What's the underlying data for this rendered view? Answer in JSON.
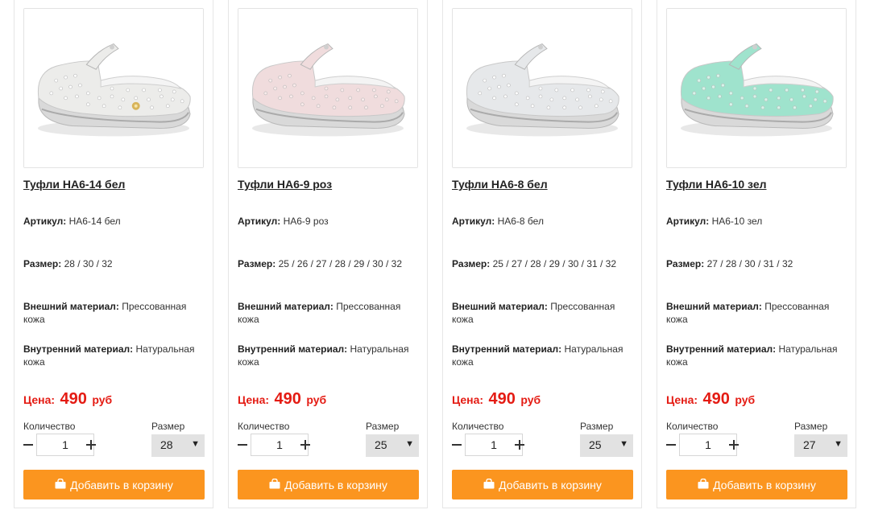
{
  "products": [
    {
      "title": "Туфли НА6-14 бел",
      "article_label": "Артикул:",
      "article": "НА6-14 бел",
      "size_label": "Размер:",
      "sizes": "28 / 30 / 32",
      "ext_label": "Внешний материал:",
      "ext_material": "Прессованная кожа",
      "int_label": "Внутренний материал:",
      "int_material": "Натуральная кожа",
      "price_label": "Цена:",
      "price": "490",
      "currency": "руб",
      "qty_label": "Количество",
      "qty": "1",
      "size_select_label": "Размер",
      "size_selected": "28",
      "cart_label": "Добавить в корзину",
      "color": "#ececea",
      "dot": "#ffffff",
      "brooch": true
    },
    {
      "title": "Туфли НА6-9 роз",
      "article_label": "Артикул:",
      "article": "НА6-9 роз",
      "size_label": "Размер:",
      "sizes": "25 / 26 / 27 / 28 / 29 / 30 / 32",
      "ext_label": "Внешний материал:",
      "ext_material": "Прессованная кожа",
      "int_label": "Внутренний материал:",
      "int_material": "Натуральная кожа",
      "price_label": "Цена:",
      "price": "490",
      "currency": "руб",
      "qty_label": "Количество",
      "qty": "1",
      "size_select_label": "Размер",
      "size_selected": "25",
      "cart_label": "Добавить в корзину",
      "color": "#f0dcdd",
      "dot": "#f9eaea",
      "brooch": false
    },
    {
      "title": "Туфли НА6-8 бел",
      "article_label": "Артикул:",
      "article": "НА6-8 бел",
      "size_label": "Размер:",
      "sizes": "25 / 27 / 28 / 29 / 30 / 31 / 32",
      "ext_label": "Внешний материал:",
      "ext_material": "Прессованная кожа",
      "int_label": "Внутренний материал:",
      "int_material": "Натуральная кожа",
      "price_label": "Цена:",
      "price": "490",
      "currency": "руб",
      "qty_label": "Количество",
      "qty": "1",
      "size_select_label": "Размер",
      "size_selected": "25",
      "cart_label": "Добавить в корзину",
      "color": "#e6e8ea",
      "dot": "#ffffff",
      "brooch": false
    },
    {
      "title": "Туфли НА6-10 зел",
      "article_label": "Артикул:",
      "article": "НА6-10 зел",
      "size_label": "Размер:",
      "sizes": "27 / 28 / 30 / 31 / 32",
      "ext_label": "Внешний материал:",
      "ext_material": "Прессованная кожа",
      "int_label": "Внутренний материал:",
      "int_material": "Натуральная кожа",
      "price_label": "Цена:",
      "price": "490",
      "currency": "руб",
      "qty_label": "Количество",
      "qty": "1",
      "size_select_label": "Размер",
      "size_selected": "27",
      "cart_label": "Добавить в корзину",
      "color": "#9fe3cd",
      "dot": "#d6f5ea",
      "brooch": false
    }
  ],
  "icons": {
    "decrement": "minus-icon",
    "increment": "plus-icon",
    "dropdown": "chevron-down-icon",
    "cart": "shopping-bag-icon",
    "product_image": "shoe-photo"
  },
  "colors": {
    "price": "#e41b13",
    "cart_button": "#fb951f",
    "select_bg": "#e2e2e2"
  }
}
